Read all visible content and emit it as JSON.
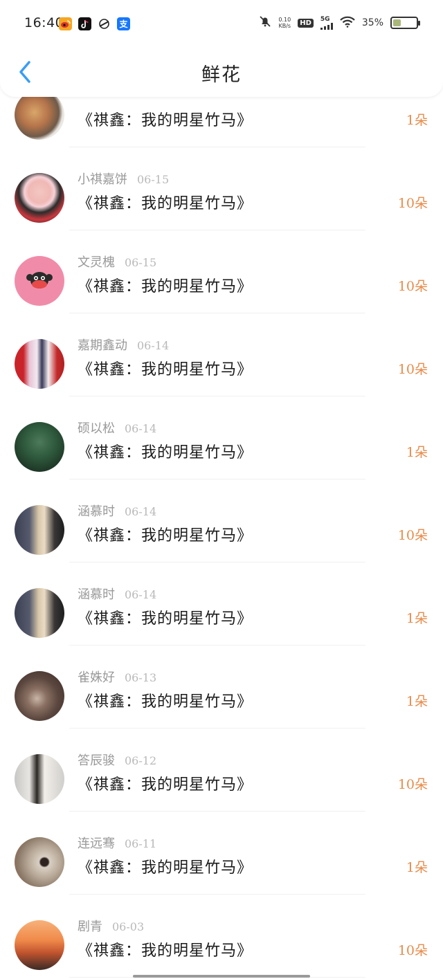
{
  "status_bar": {
    "time": "16:40",
    "net_speed_value": "0.10",
    "net_speed_unit": "KB/s",
    "hd": "HD",
    "network": "5G",
    "battery_text": "35%",
    "battery_level": 0.35,
    "apps": [
      {
        "icon": "weibo-icon",
        "color": "#f5a623"
      },
      {
        "icon": "tiktok-icon",
        "color": "#111111"
      },
      {
        "icon": "browser-icon",
        "color": "#222222"
      },
      {
        "icon": "alipay-icon",
        "color": "#1677ff",
        "glyph": "支"
      }
    ]
  },
  "header": {
    "title": "鲜花",
    "back_icon": "chevron-left-icon",
    "accent": "#3a9df5"
  },
  "colors": {
    "amount": "#e88b4a",
    "meta": "#999999"
  },
  "records": [
    {
      "name": "",
      "date": "",
      "book": "《祺鑫：我的明星竹马》",
      "amount": "1朵"
    },
    {
      "name": "小祺嘉饼",
      "date": "06-15",
      "book": "《祺鑫：我的明星竹马》",
      "amount": "10朵"
    },
    {
      "name": "文灵槐",
      "date": "06-15",
      "book": "《祺鑫：我的明星竹马》",
      "amount": "10朵"
    },
    {
      "name": "嘉期鑫动",
      "date": "06-14",
      "book": "《祺鑫：我的明星竹马》",
      "amount": "10朵"
    },
    {
      "name": "硕以松",
      "date": "06-14",
      "book": "《祺鑫：我的明星竹马》",
      "amount": "1朵"
    },
    {
      "name": "涵慕时",
      "date": "06-14",
      "book": "《祺鑫：我的明星竹马》",
      "amount": "10朵"
    },
    {
      "name": "涵慕时",
      "date": "06-14",
      "book": "《祺鑫：我的明星竹马》",
      "amount": "1朵"
    },
    {
      "name": "雀姝好",
      "date": "06-13",
      "book": "《祺鑫：我的明星竹马》",
      "amount": "1朵"
    },
    {
      "name": "答辰骏",
      "date": "06-12",
      "book": "《祺鑫：我的明星竹马》",
      "amount": "10朵"
    },
    {
      "name": "连远骞",
      "date": "06-11",
      "book": "《祺鑫：我的明星竹马》",
      "amount": "1朵"
    },
    {
      "name": "剧青",
      "date": "06-03",
      "book": "《祺鑫：我的明星竹马》",
      "amount": "10朵"
    }
  ]
}
